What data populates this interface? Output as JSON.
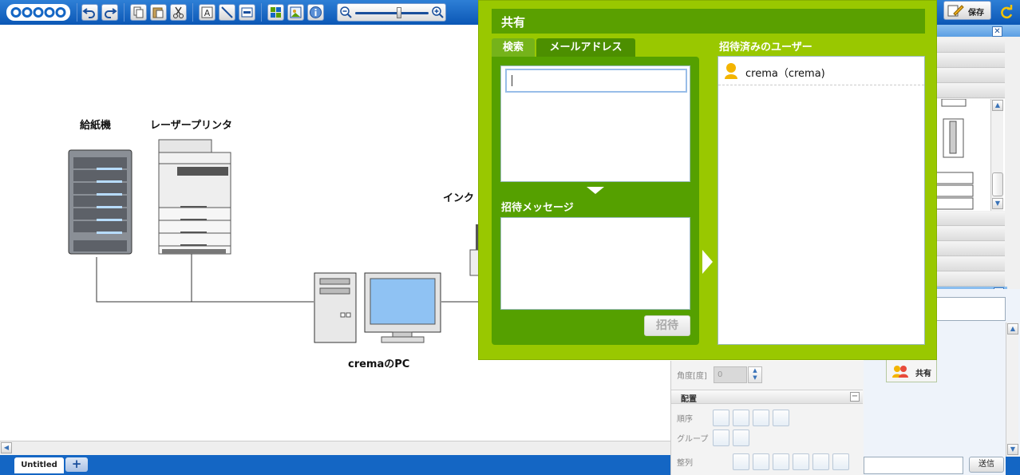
{
  "toolbar": {
    "logo_text": "cacoo",
    "save_label": "保存"
  },
  "canvas": {
    "labels": {
      "feeder": "給紙機",
      "laser_printer": "レーザープリンタ",
      "inkjet_partial": "インク",
      "pc": "cremaのPC"
    }
  },
  "tabs": {
    "page_tab": "Untitled",
    "add_tab": "+"
  },
  "share_dialog": {
    "title": "共有",
    "tab_search": "検索",
    "tab_email": "メールアドレス",
    "message_label": "招待メッセージ",
    "invite_button": "招待",
    "invited_label": "招待済みのユーザー",
    "invited_users": [
      {
        "name": "crema（crema)"
      }
    ]
  },
  "properties": {
    "angle_label": "角度[度]",
    "angle_value": "0",
    "arrange_section": "配置",
    "order_label": "順序",
    "group_label": "グループ",
    "align_label": "整列"
  },
  "side": {
    "share_tab": "共有",
    "send_button": "送信"
  },
  "colors": {
    "toolbar_blue": "#0b57b5",
    "dialog_green": "#99c800",
    "dialog_dark_green": "#55a000"
  }
}
